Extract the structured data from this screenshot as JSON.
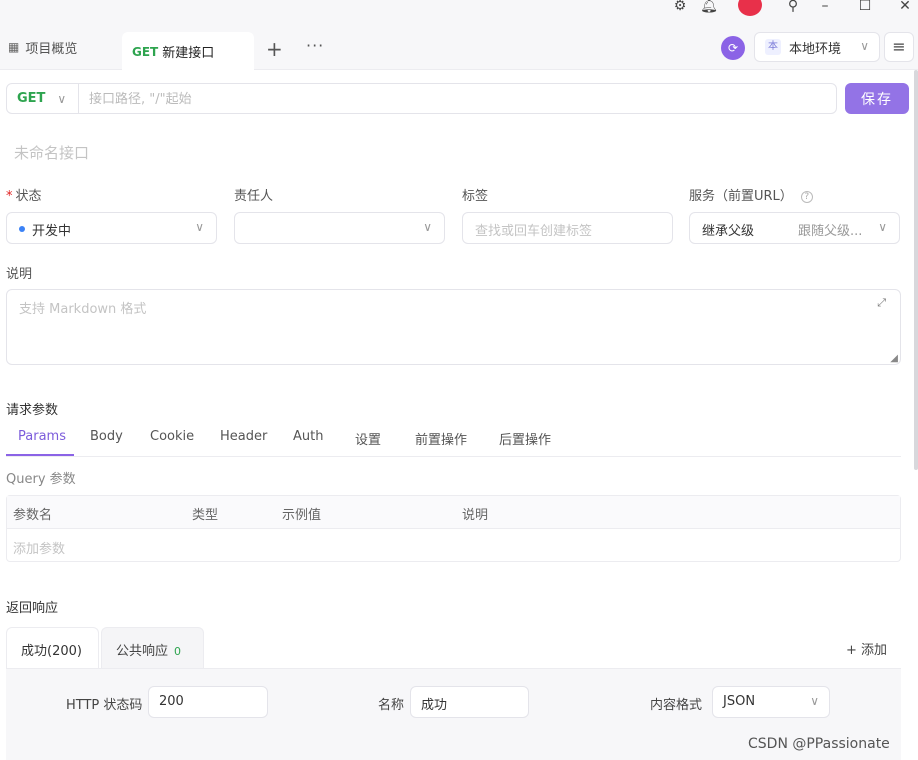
{
  "tabs": {
    "overview_label": "项目概览",
    "active_method": "GET",
    "active_label": "新建接口",
    "add_symbol": "+",
    "more_symbol": "···"
  },
  "env": {
    "badge": "本",
    "label": "本地环境"
  },
  "request": {
    "method": "GET",
    "path_placeholder": "接口路径, \"/\"起始",
    "save_label": "保存"
  },
  "name_placeholder": "未命名接口",
  "fields": {
    "status_label": "状态",
    "status_value": "开发中",
    "owner_label": "责任人",
    "tag_label": "标签",
    "tag_placeholder": "查找或回车创建标签",
    "service_label": "服务（前置URL）",
    "service_value": "继承父级",
    "service_value2": "跟随父级..."
  },
  "description": {
    "label": "说明",
    "placeholder": "支持 Markdown 格式"
  },
  "request_params": {
    "title": "请求参数",
    "tabs": [
      "Params",
      "Body",
      "Cookie",
      "Header",
      "Auth",
      "设置",
      "前置操作",
      "后置操作"
    ],
    "active_tab": "Params",
    "query_label": "Query 参数",
    "columns": [
      "参数名",
      "类型",
      "示例值",
      "说明"
    ],
    "add_placeholder": "添加参数"
  },
  "response": {
    "title": "返回响应",
    "tabs": [
      {
        "label": "成功(200)"
      },
      {
        "label": "公共响应",
        "count": "0"
      }
    ],
    "add_label": "添加",
    "http_status_label": "HTTP 状态码",
    "http_status_value": "200",
    "name_label": "名称",
    "name_value": "成功",
    "format_label": "内容格式",
    "format_value": "JSON"
  },
  "watermark": "CSDN @PPassionate",
  "colors": {
    "accent": "#8b63e6",
    "method_get": "#2ea44f",
    "status_dot": "#3b82f6"
  }
}
